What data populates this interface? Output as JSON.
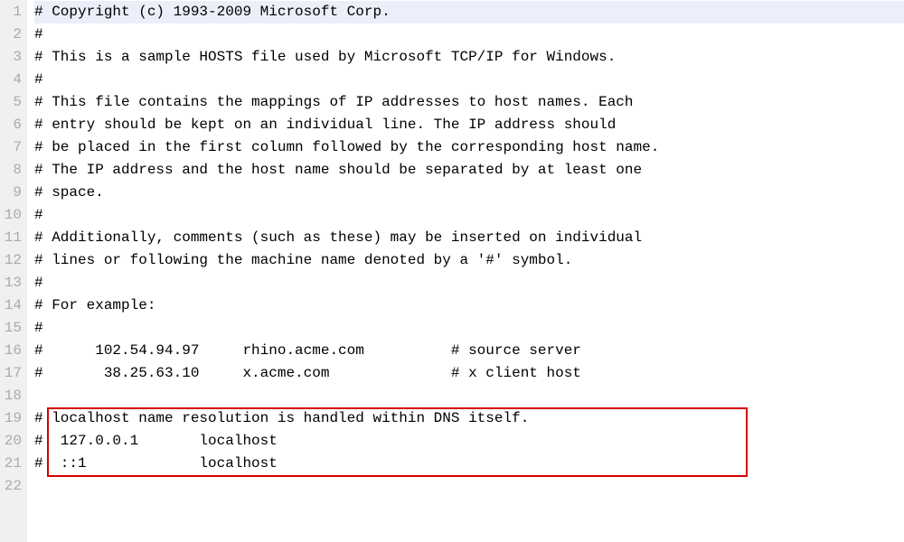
{
  "editor": {
    "line_count": 22,
    "highlight_line": 1,
    "lines": {
      "l1": "# Copyright (c) 1993-2009 Microsoft Corp.",
      "l2": "#",
      "l3": "# This is a sample HOSTS file used by Microsoft TCP/IP for Windows.",
      "l4": "#",
      "l5": "# This file contains the mappings of IP addresses to host names. Each",
      "l6": "# entry should be kept on an individual line. The IP address should",
      "l7": "# be placed in the first column followed by the corresponding host name.",
      "l8": "# The IP address and the host name should be separated by at least one",
      "l9": "# space.",
      "l10": "#",
      "l11": "# Additionally, comments (such as these) may be inserted on individual",
      "l12": "# lines or following the machine name denoted by a '#' symbol.",
      "l13": "#",
      "l14": "# For example:",
      "l15": "#",
      "l16": "#      102.54.94.97     rhino.acme.com          # source server",
      "l17": "#       38.25.63.10     x.acme.com              # x client host",
      "l18": "",
      "l19": "# localhost name resolution is handled within DNS itself.",
      "l20": "#  127.0.0.1       localhost",
      "l21": "#  ::1             localhost",
      "l22": ""
    },
    "line_numbers": {
      "n1": "1",
      "n2": "2",
      "n3": "3",
      "n4": "4",
      "n5": "5",
      "n6": "6",
      "n7": "7",
      "n8": "8",
      "n9": "9",
      "n10": "10",
      "n11": "11",
      "n12": "12",
      "n13": "13",
      "n14": "14",
      "n15": "15",
      "n16": "16",
      "n17": "17",
      "n18": "18",
      "n19": "19",
      "n20": "20",
      "n21": "21",
      "n22": "22"
    },
    "redbox": {
      "top_px": "451",
      "left_px": "22",
      "width_px": "775",
      "height_px": "77"
    }
  }
}
